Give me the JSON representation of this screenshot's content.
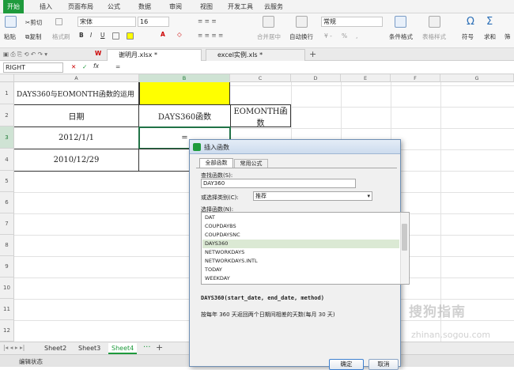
{
  "menu": {
    "items": [
      "开始",
      "插入",
      "页面布局",
      "公式",
      "数据",
      "审阅",
      "视图",
      "开发工具",
      "云服务"
    ]
  },
  "ribbon": {
    "paste": "粘贴",
    "cut": "剪切",
    "copy": "复制",
    "format_painter": "格式刷",
    "font_name": "宋体",
    "font_size": "16",
    "bold": "B",
    "italic": "I",
    "underline": "U",
    "merge_center": "合并居中",
    "wrap_text": "自动换行",
    "number_format": "常规",
    "conditional_format": "条件格式",
    "table_style": "表格样式",
    "symbol": "符号",
    "sum": "求和",
    "filter": "筛",
    "font_color_letter": "A",
    "pct": "%",
    "thousands": ","
  },
  "file_tabs": [
    {
      "name": "谢明月.xlsx *",
      "active": true
    },
    {
      "name": "excel实例.xls *",
      "active": false
    }
  ],
  "formula_bar": {
    "name_box": "RIGHT",
    "cancel": "✕",
    "enter": "✓",
    "fx": "fx",
    "content": "="
  },
  "columns": [
    "A",
    "B",
    "C",
    "D",
    "E",
    "F",
    "G"
  ],
  "rows": [
    "1",
    "2",
    "3",
    "4",
    "5",
    "6",
    "7",
    "8",
    "9",
    "10",
    "11",
    "12"
  ],
  "sheet": {
    "title": "DAYS360与EOMONTH函数的运用",
    "header_date": "日期",
    "header_days360": "DAYS360函数",
    "header_eomonth": "EOMONTH函数",
    "date1": "2012/1/1",
    "date2": "2010/12/29",
    "b3": "="
  },
  "sheet_tabs": [
    "Sheet2",
    "Sheet3",
    "Sheet4"
  ],
  "active_sheet": "Sheet4",
  "status": {
    "mode": "编辑状态"
  },
  "dialog": {
    "title": "插入函数",
    "tabs": [
      "全部函数",
      "常用公式"
    ],
    "search_label": "查找函数(S):",
    "search_value": "DAY360",
    "category_label": "或选择类别(C):",
    "category_value": "推荐",
    "list_label": "选择函数(N):",
    "functions": [
      "DAT",
      "COUPDAYBS",
      "COUPDAYSNC",
      "DAYS360",
      "NETWORKDAYS",
      "NETWORKDAYS.INTL",
      "TODAY",
      "WEEKDAY"
    ],
    "selected_function": "DAYS360",
    "signature": "DAYS360(start_date, end_date, method)",
    "description": "按每年 360 天返回两个日期间相差的天数(每月 30 天)",
    "ok": "确定",
    "cancel": "取消"
  },
  "watermark": {
    "text": "搜狗指南",
    "url": "zhinan.sogou.com"
  },
  "colors": {
    "accent": "#1e9a3c",
    "yellow_cell": "#ffff00",
    "selection": "#217346"
  }
}
